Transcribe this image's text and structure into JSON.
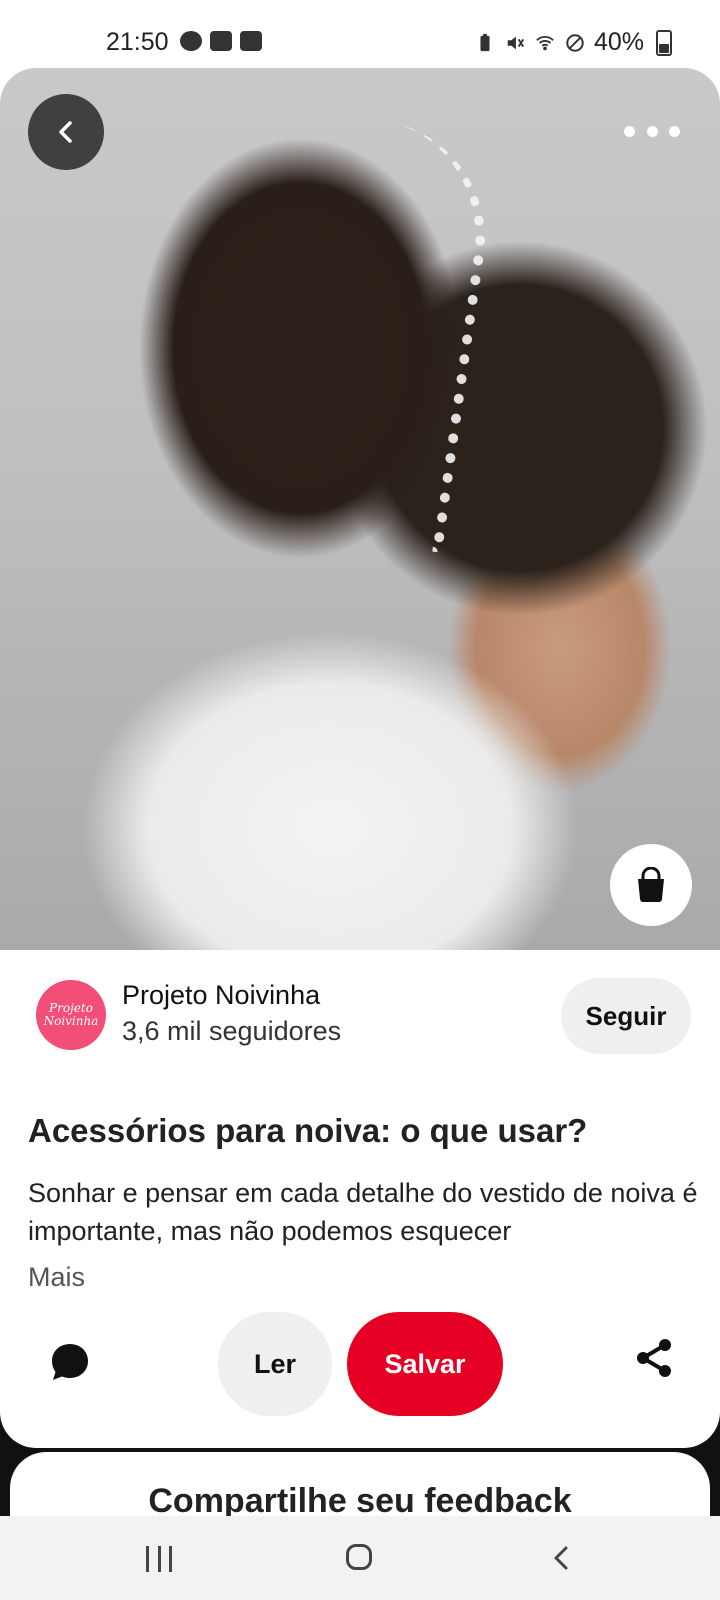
{
  "status_bar": {
    "time": "21:50",
    "left_icons": [
      "chrome-icon",
      "gallery-icon",
      "data-saver-icon"
    ],
    "right_icons": [
      "battery-saver-icon",
      "mute-icon",
      "wifi-icon",
      "do-not-disturb-icon"
    ],
    "battery": "40%"
  },
  "pin": {
    "image_alt_icons": [
      "back-icon",
      "more-icon",
      "shopping-bag-icon"
    ],
    "creator": {
      "avatar_text": "Projeto Noivinha",
      "name": "Projeto Noivinha",
      "followers": "3,6 mil seguidores",
      "follow_label": "Seguir"
    },
    "title": "Acessórios para noiva: o que usar?",
    "description": "Sonhar e pensar em cada detalhe do vestido de noiva é importante, mas não podemos esquecer",
    "more_label": "Mais",
    "actions": {
      "read_label": "Ler",
      "save_label": "Salvar"
    }
  },
  "feedback": {
    "title": "Compartilhe seu feedback"
  },
  "colors": {
    "save": "#e60023",
    "avatar": "#f24e78"
  }
}
